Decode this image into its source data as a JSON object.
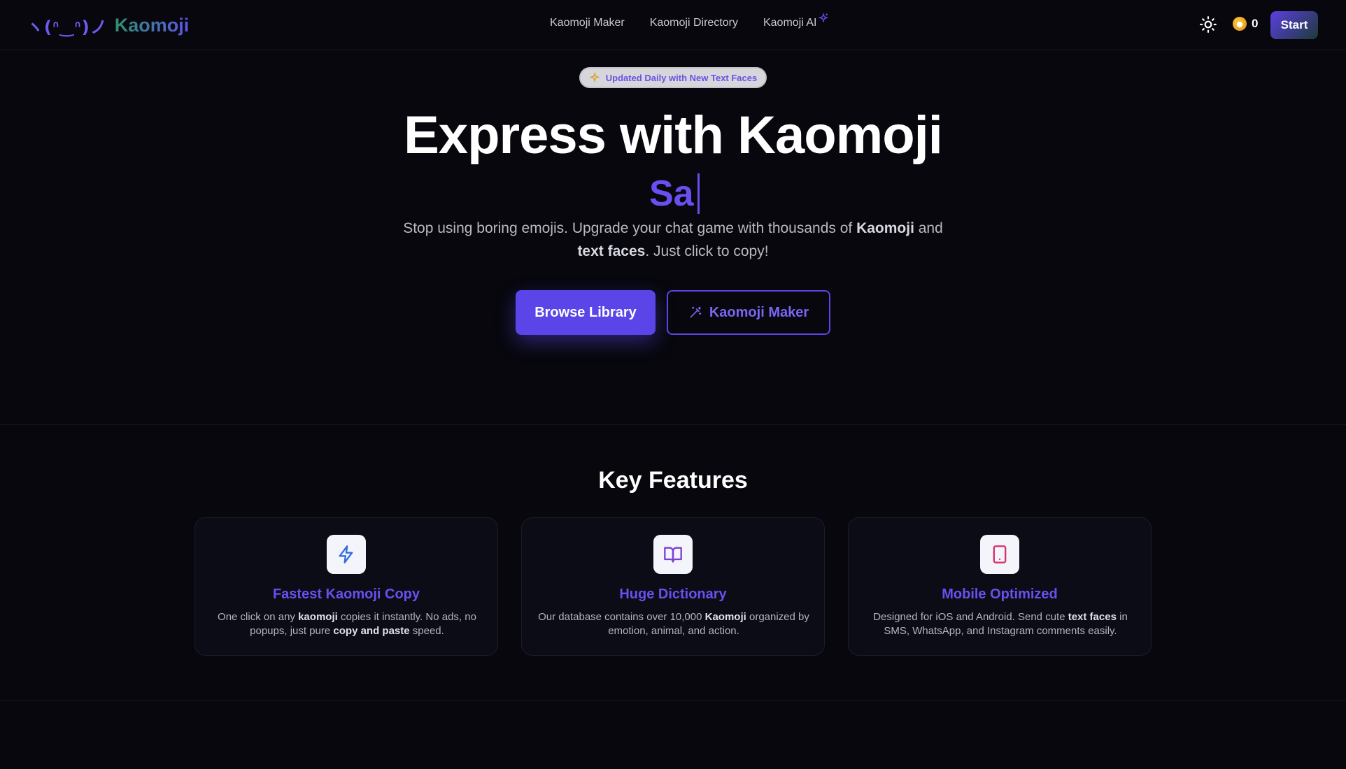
{
  "header": {
    "logo_face": "ヽ(ᐢ‿ᐢ)ノ",
    "logo_text": "Kaomoji",
    "nav": [
      {
        "label": "Kaomoji Maker"
      },
      {
        "label": "Kaomoji Directory"
      },
      {
        "label": "Kaomoji AI"
      }
    ],
    "coin_count": "0",
    "start_label": "Start"
  },
  "hero": {
    "badge": "Updated Daily with New Text Faces",
    "title": "Express with Kaomoji",
    "typed_text": "Sa",
    "subtitle": {
      "p1": "Stop using boring emojis. Upgrade your chat game with thousands of ",
      "b1": "Kaomoji",
      "p2": " and ",
      "b2": "text faces",
      "p3": ". Just click to copy!"
    },
    "primary_button": "Browse Library",
    "secondary_button": "Kaomoji Maker"
  },
  "features": {
    "title": "Key Features",
    "cards": [
      {
        "icon": "lightning-icon",
        "title": "Fastest Kaomoji Copy",
        "d1": "One click on any ",
        "b1": "kaomoji",
        "d2": " copies it instantly. No ads, no popups, just pure ",
        "b2": "copy and paste",
        "d3": " speed."
      },
      {
        "icon": "book-icon",
        "title": "Huge Dictionary",
        "d1": "Our database contains over 10,000 ",
        "b1": "Kaomoji",
        "d2": " organized by emotion, animal, and action."
      },
      {
        "icon": "tablet-icon",
        "title": "Mobile Optimized",
        "d1": "Designed for iOS and Android. Send cute ",
        "b1": "text faces",
        "d2": " in SMS, WhatsApp, and Instagram comments easily."
      }
    ]
  },
  "colors": {
    "accent": "#5b45e8",
    "background": "#07070d",
    "brand_green": "#2e8f6e"
  }
}
